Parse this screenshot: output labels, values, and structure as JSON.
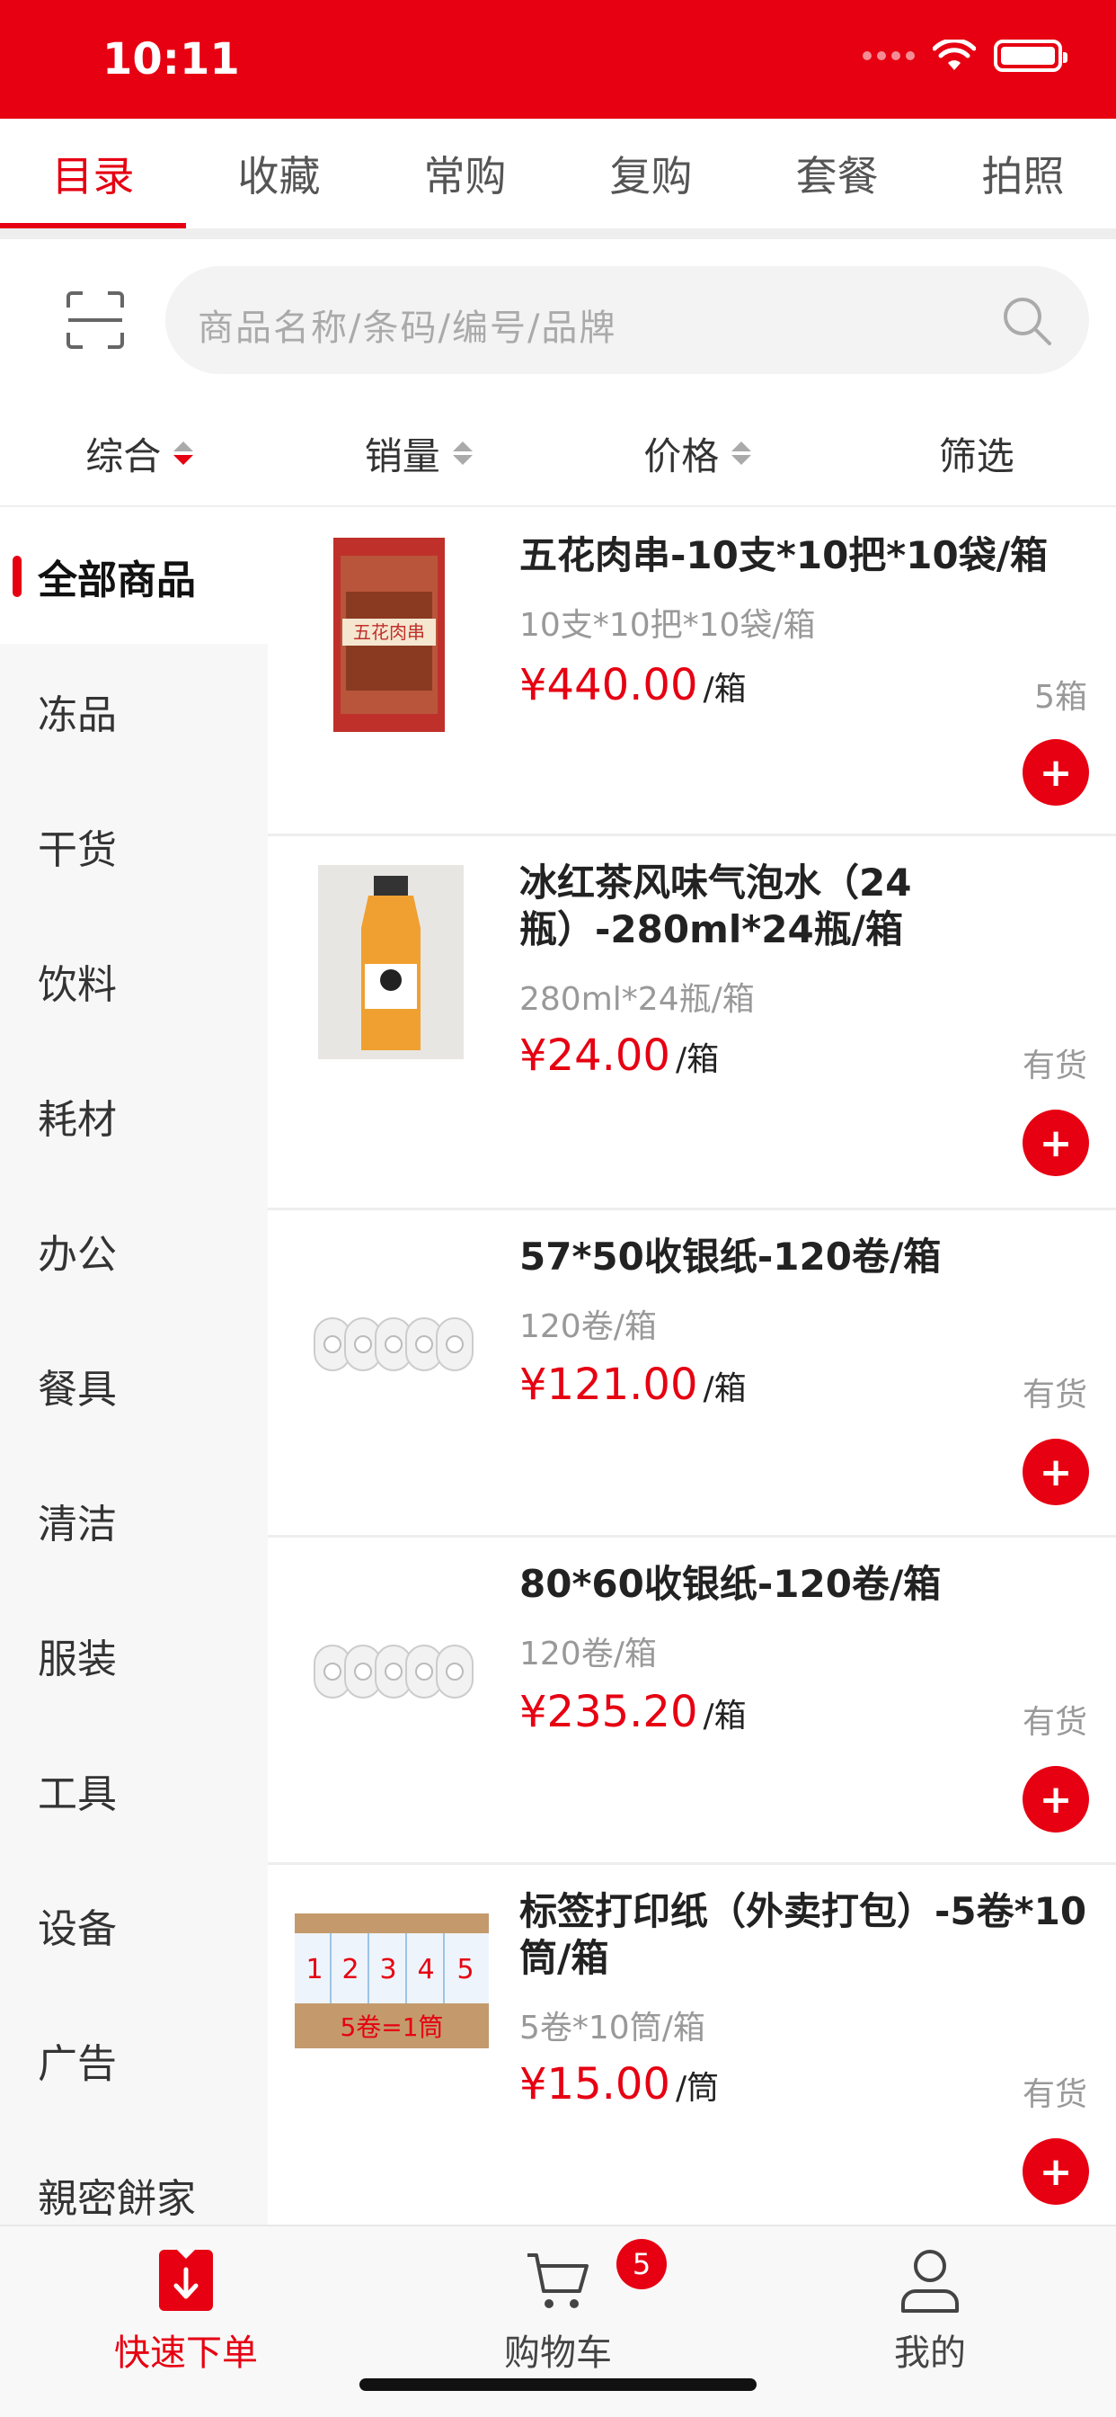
{
  "status_bar": {
    "time": "10:11"
  },
  "top_tabs": [
    {
      "label": "目录",
      "active": true
    },
    {
      "label": "收藏",
      "active": false
    },
    {
      "label": "常购",
      "active": false
    },
    {
      "label": "复购",
      "active": false
    },
    {
      "label": "套餐",
      "active": false
    },
    {
      "label": "拍照",
      "active": false
    }
  ],
  "search": {
    "placeholder": "商品名称/条码/编号/品牌"
  },
  "sort": [
    {
      "label": "综合",
      "active": true
    },
    {
      "label": "销量",
      "active": false
    },
    {
      "label": "价格",
      "active": false
    },
    {
      "label": "筛选",
      "active": false
    }
  ],
  "sidebar": {
    "items": [
      {
        "label": "全部商品",
        "active": true
      },
      {
        "label": "冻品"
      },
      {
        "label": "干货"
      },
      {
        "label": "饮料"
      },
      {
        "label": "耗材"
      },
      {
        "label": "办公"
      },
      {
        "label": "餐具"
      },
      {
        "label": "清洁"
      },
      {
        "label": "服装"
      },
      {
        "label": "工具"
      },
      {
        "label": "设备"
      },
      {
        "label": "广告"
      },
      {
        "label": "親密餅家"
      }
    ]
  },
  "products": [
    {
      "name": "五花肉串-10支*10把*10袋/箱",
      "spec": "10支*10把*10袋/箱",
      "price": "¥440.00",
      "unit": "/箱",
      "stock": "5箱",
      "image_text": "五花肉串"
    },
    {
      "name": "冰红茶风味气泡水（24瓶）-280ml*24瓶/箱",
      "spec": "280ml*24瓶/箱",
      "price": "¥24.00",
      "unit": "/箱",
      "stock": "有货"
    },
    {
      "name": "57*50收银纸-120卷/箱",
      "spec": "120卷/箱",
      "price": "¥121.00",
      "unit": "/箱",
      "stock": "有货"
    },
    {
      "name": "80*60收银纸-120卷/箱",
      "spec": "120卷/箱",
      "price": "¥235.20",
      "unit": "/箱",
      "stock": "有货"
    },
    {
      "name": "标签打印纸（外卖打包）-5卷*10筒/箱",
      "spec": "5卷*10筒/箱",
      "price": "¥15.00",
      "unit": "/筒",
      "stock": "有货",
      "image_text": "5卷=1筒",
      "image_numbers": [
        "1",
        "2",
        "3",
        "4",
        "5"
      ]
    }
  ],
  "bottom_nav": [
    {
      "label": "快速下单",
      "icon": "quick-order-icon",
      "active": true
    },
    {
      "label": "购物车",
      "icon": "cart-icon",
      "badge": "5"
    },
    {
      "label": "我的",
      "icon": "user-icon"
    }
  ],
  "colors": {
    "accent": "#e60012",
    "sidebar_bg": "#f7f7f7",
    "muted_text": "#999999"
  }
}
